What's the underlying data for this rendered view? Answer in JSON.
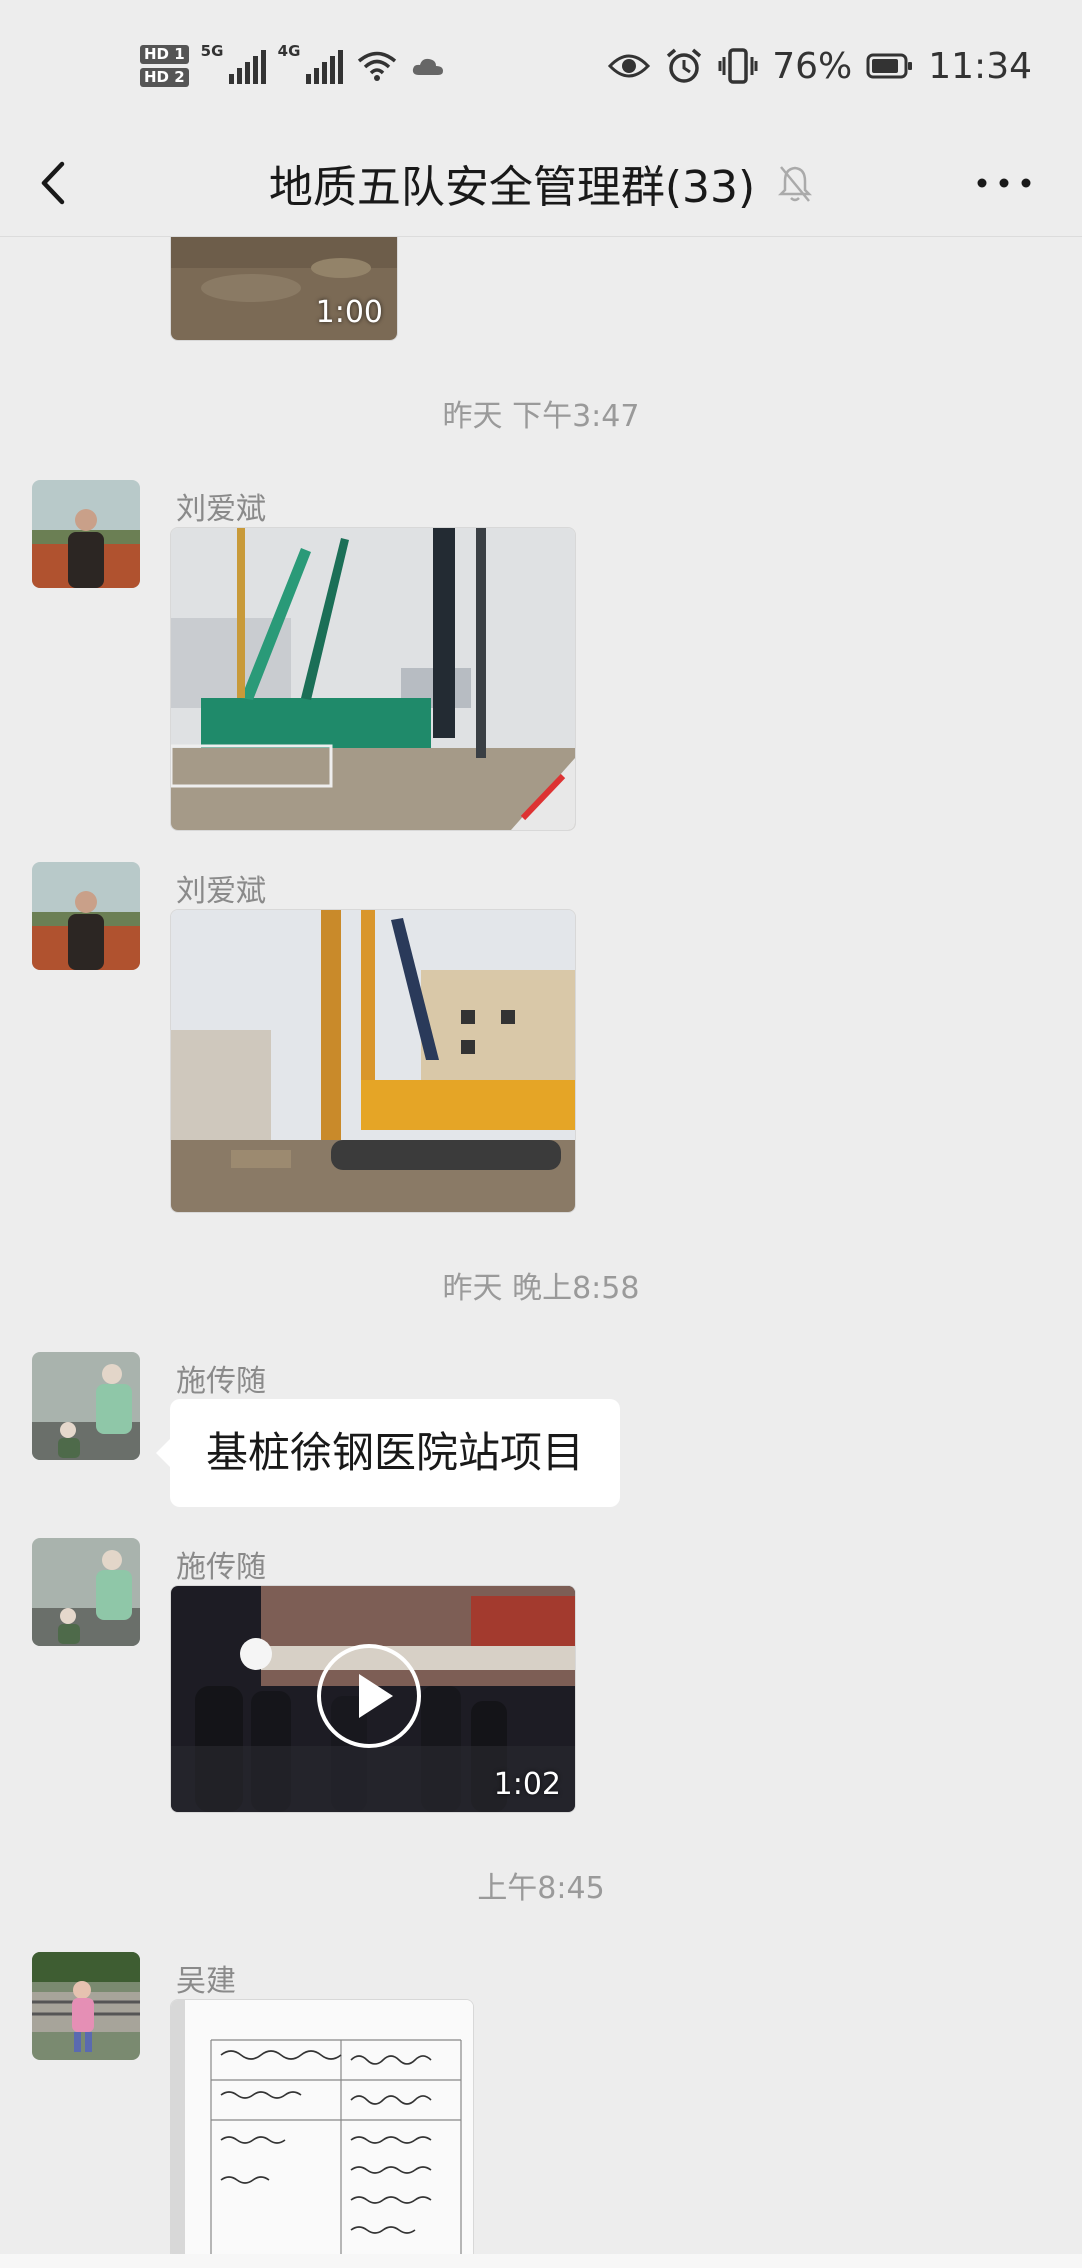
{
  "status_bar": {
    "sim1": "HD 1",
    "sim2": "HD 2",
    "net1": "5G",
    "net2": "4G",
    "battery_percent": "76%",
    "time": "11:34"
  },
  "header": {
    "title": "地质五队安全管理群(33)"
  },
  "messages": {
    "video_top": {
      "duration": "1:00"
    },
    "time1": "昨天 下午3:47",
    "msg1": {
      "sender": "刘爱斌"
    },
    "msg2": {
      "sender": "刘爱斌"
    },
    "time2": "昨天 晚上8:58",
    "msg3": {
      "sender": "施传随",
      "text": "基桩徐钢医院站项目"
    },
    "msg4": {
      "sender": "施传随",
      "duration": "1:02"
    },
    "time3": "上午8:45",
    "msg5": {
      "sender": "吴建"
    }
  }
}
